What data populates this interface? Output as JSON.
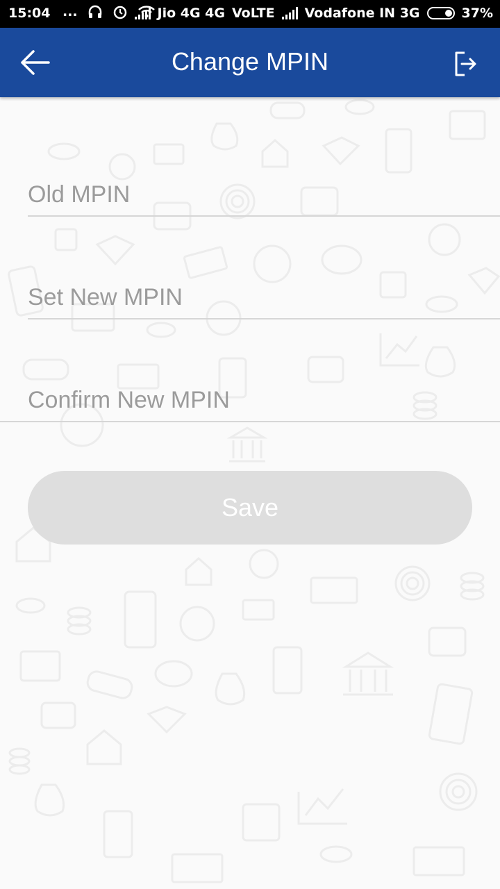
{
  "status_bar": {
    "time": "15:04",
    "dots": "...",
    "carrier1": "Jio 4G 4G",
    "volte": "VoLTE",
    "carrier2": "Vodafone IN 3G",
    "battery": "37%"
  },
  "app_bar": {
    "title": "Change MPIN",
    "back_icon": "arrow-left-icon",
    "logout_icon": "logout-icon",
    "color": "#1a4a9c"
  },
  "form": {
    "old_mpin": {
      "placeholder": "Old MPIN",
      "value": ""
    },
    "new_mpin": {
      "placeholder": "Set New MPIN",
      "value": ""
    },
    "confirm_mpin": {
      "placeholder": "Confirm New MPIN",
      "value": ""
    },
    "save_label": "Save",
    "save_color": "#dedede"
  },
  "background_icons": [
    "coin-icon",
    "wallet-icon",
    "rupee-badge-icon",
    "fingerprint-icon",
    "piggy-bank-icon",
    "bank-icon",
    "briefcase-icon",
    "car-icon",
    "house-icon",
    "diamond-icon",
    "money-bag-icon",
    "calculator-icon",
    "card-machine-icon",
    "user-circle-icon",
    "chart-icon"
  ]
}
